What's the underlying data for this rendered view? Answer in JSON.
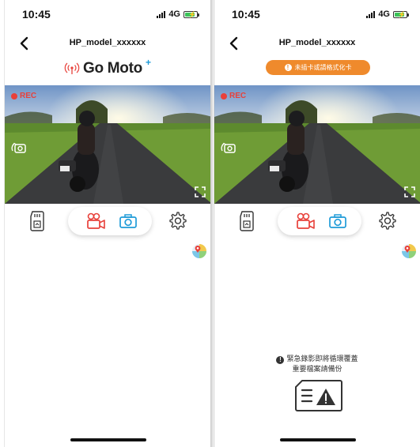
{
  "left_screen": {
    "status": {
      "time": "10:45",
      "network": "4G"
    },
    "title": "HP_model_xxxxxx",
    "brand": {
      "text": "Go Moto",
      "plus": "+"
    },
    "rec_label": "REC"
  },
  "right_screen": {
    "status": {
      "time": "10:45",
      "network": "4G"
    },
    "title": "HP_model_xxxxxx",
    "warning_pill": "未插卡或請格式化卡",
    "rec_label": "REC",
    "notice": {
      "line1": "緊急錄影即將循環覆蓋",
      "line2": "重要檔案請備份"
    }
  },
  "colors": {
    "accent_red": "#e8403a",
    "accent_blue": "#1f9bd8",
    "warning_orange": "#ef8a2c"
  },
  "icons": [
    "back-icon",
    "signal-icon",
    "battery-icon",
    "wifi-icon",
    "rec-dot-icon",
    "camera-switch-icon",
    "fullscreen-icon",
    "sd-card-icon",
    "video-camera-icon",
    "photo-camera-icon",
    "gear-icon",
    "map-pin-icon",
    "alert-icon",
    "sd-warning-icon"
  ]
}
